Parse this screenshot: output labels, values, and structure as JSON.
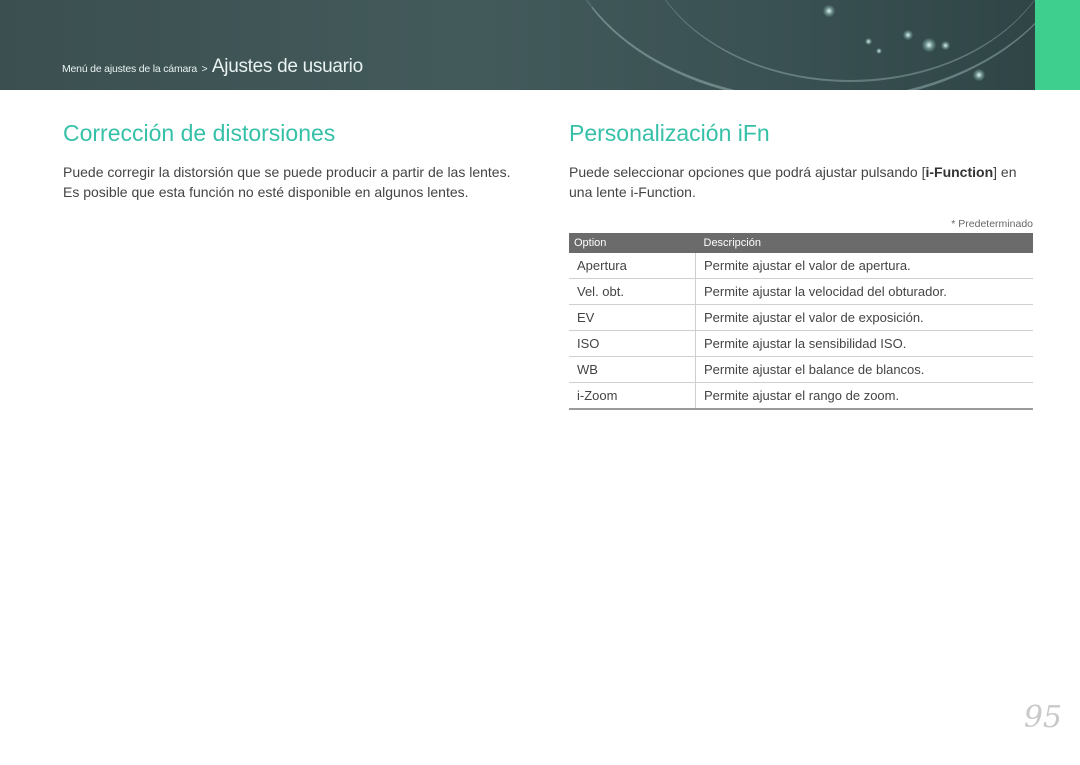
{
  "header": {
    "breadcrumb_parent": "Menú de ajustes de la cámara",
    "breadcrumb_separator": ">",
    "breadcrumb_current": "Ajustes de usuario",
    "accent_color": "#3ecf8e"
  },
  "left": {
    "title": "Corrección de distorsiones",
    "lines": [
      "Puede corregir la distorsión que se puede producir a partir de las lentes.",
      "Es posible que esta función no esté disponible en algunos lentes."
    ]
  },
  "right": {
    "title": "Personalización iFn",
    "para_pre": "Puede seleccionar opciones que podrá ajustar pulsando [",
    "para_bold": "i-Function",
    "para_post": "] en",
    "para_line2": "una lente i-Function.",
    "default_note": "* Predeterminado",
    "table": {
      "headers": [
        "Option",
        "Descripción"
      ],
      "rows": [
        {
          "option": "Apertura",
          "description": "Permite ajustar el valor de apertura."
        },
        {
          "option": "Vel. obt.",
          "description": "Permite ajustar la velocidad del obturador."
        },
        {
          "option": "EV",
          "description": "Permite ajustar el valor de exposición."
        },
        {
          "option": "ISO",
          "description": "Permite ajustar la sensibilidad ISO."
        },
        {
          "option": "WB",
          "description": "Permite ajustar el balance de blancos."
        },
        {
          "option": "i-Zoom",
          "description": "Permite ajustar el rango de zoom."
        }
      ]
    }
  },
  "page_number": "95",
  "title_color": "#36c0a8"
}
